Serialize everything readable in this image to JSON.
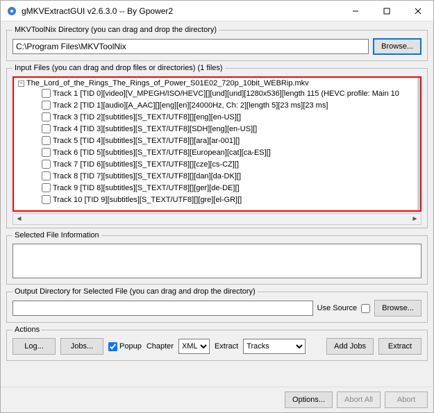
{
  "title": "gMKVExtractGUI v2.6.3.0 -- By Gpower2",
  "toolnix": {
    "legend": "MKVToolNix Directory (you can drag and drop the directory)",
    "path": "C:\\Program Files\\MKVToolNix",
    "browse": "Browse..."
  },
  "inputFiles": {
    "legend": "Input Files (you can drag and drop files or directories) (1 files)",
    "fileName": "The_Lord_of_the_Rings_The_Rings_of_Power_S01E02_720p_10bit_WEBRip.mkv",
    "tracks": [
      "Track 1 [TID 0][video][V_MPEGH/ISO/HEVC][][und][und][1280x536][length 115 (HEVC profile: Main 10",
      "Track 2 [TID 1][audio][A_AAC][][eng][en][24000Hz, Ch: 2][length 5][23 ms][23 ms]",
      "Track 3 [TID 2][subtitles][S_TEXT/UTF8][][eng][en-US][]",
      "Track 4 [TID 3][subtitles][S_TEXT/UTF8][SDH][eng][en-US][]",
      "Track 5 [TID 4][subtitles][S_TEXT/UTF8][][ara][ar-001][]",
      "Track 6 [TID 5][subtitles][S_TEXT/UTF8][European][cat][ca-ES][]",
      "Track 7 [TID 6][subtitles][S_TEXT/UTF8][][cze][cs-CZ][]",
      "Track 8 [TID 7][subtitles][S_TEXT/UTF8][][dan][da-DK][]",
      "Track 9 [TID 8][subtitles][S_TEXT/UTF8][][ger][de-DE][]",
      "Track 10 [TID 9][subtitles][S_TEXT/UTF8][][gre][el-GR][]"
    ]
  },
  "selectedInfo": {
    "legend": "Selected File Information"
  },
  "outputDir": {
    "legend": "Output Directory for Selected File (you can drag and drop the directory)",
    "path": "",
    "useSource": "Use Source",
    "browse": "Browse..."
  },
  "actions": {
    "legend": "Actions",
    "log": "Log...",
    "jobs": "Jobs...",
    "popup": "Popup",
    "chapterLabel": "Chapter",
    "chapterValue": "XML",
    "extractLabel": "Extract",
    "extractValue": "Tracks",
    "addJobs": "Add Jobs",
    "extract": "Extract"
  },
  "footer": {
    "options": "Options...",
    "abortAll": "Abort All",
    "abort": "Abort"
  }
}
